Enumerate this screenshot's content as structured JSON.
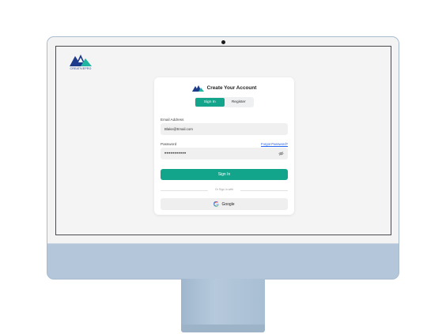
{
  "brand": {
    "text": "CREATIVEPRO"
  },
  "card": {
    "title": "Create Your Account",
    "tabs": [
      {
        "label": "Sign In",
        "active": true
      },
      {
        "label": "Register",
        "active": false
      }
    ],
    "email": {
      "label": "Email Address",
      "value": "Blake@Email.com"
    },
    "password": {
      "label": "Password",
      "forgot_link": "Forgot Password?",
      "masked_value": "•••••••••••"
    },
    "signin_button": "Sign In",
    "divider_text": "Or Sign in with",
    "google_button": "Google"
  },
  "colors": {
    "accent": "#13a58c",
    "link": "#2563eb",
    "logo_navy": "#1e3a8a",
    "logo_teal": "#1fb5a0",
    "stand": "#b3c6da"
  },
  "icons": [
    "brand-logo-icon",
    "eye-off-icon",
    "google-icon"
  ]
}
